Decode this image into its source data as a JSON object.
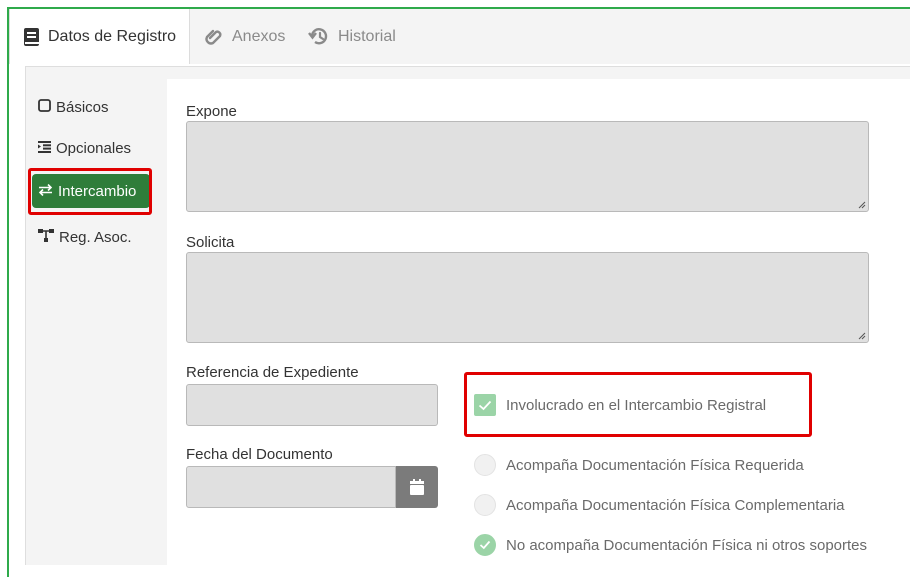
{
  "tabs": [
    {
      "label": "Datos de Registro",
      "icon": "book-icon",
      "active": true
    },
    {
      "label": "Anexos",
      "icon": "paperclip-icon",
      "active": false
    },
    {
      "label": "Historial",
      "icon": "history-icon",
      "active": false
    }
  ],
  "sidenav": {
    "items": [
      {
        "label": "Básicos",
        "icon": "square-icon"
      },
      {
        "label": "Opcionales",
        "icon": "list-indent-icon"
      },
      {
        "label": "Intercambio",
        "icon": "exchange-icon",
        "active": true
      },
      {
        "label": "Reg. Asoc.",
        "icon": "sitemap-icon"
      }
    ]
  },
  "form": {
    "expone_label": "Expone",
    "solicita_label": "Solicita",
    "referencia_label": "Referencia de Expediente",
    "fecha_label": "Fecha del Documento",
    "involucrado_label": "Involucrado en el Intercambio Registral",
    "doc_options": [
      {
        "label": "Acompaña Documentación Física Requerida",
        "selected": false
      },
      {
        "label": "Acompaña Documentación Física Complementaria",
        "selected": false
      },
      {
        "label": "No acompaña Documentación Física ni otros soportes",
        "selected": true
      }
    ]
  },
  "colors": {
    "frame": "#2faa4b",
    "active_nav": "#2f7d3a",
    "highlight": "#e00000",
    "check_fill": "#9bd4a7"
  }
}
